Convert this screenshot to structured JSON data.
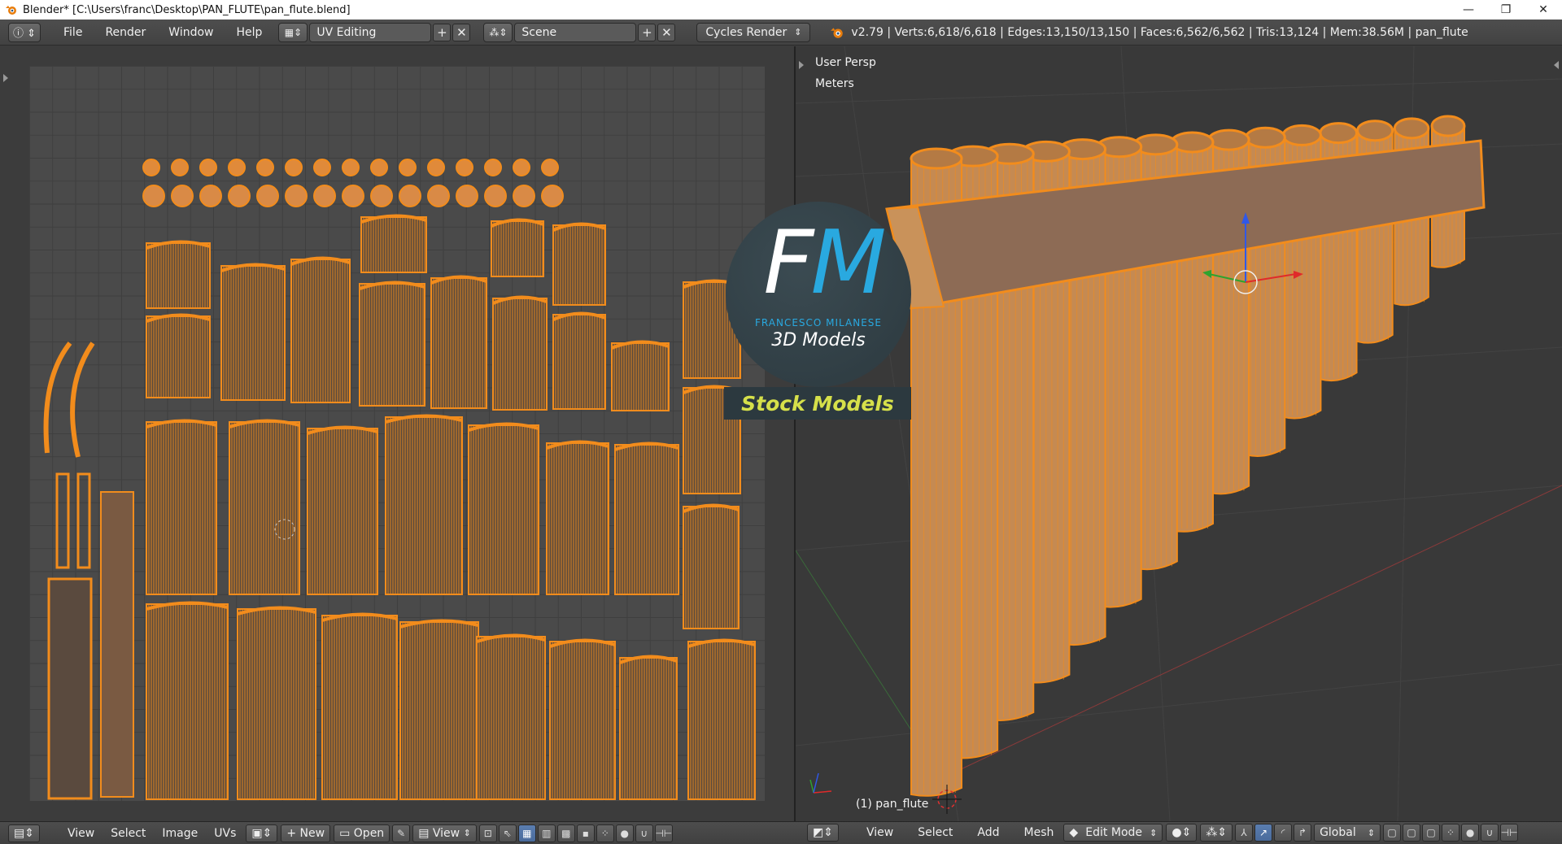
{
  "window": {
    "title": "Blender* [C:\\Users\\franc\\Desktop\\PAN_FLUTE\\pan_flute.blend]",
    "minimize": "—",
    "restore": "❐",
    "close": "✕"
  },
  "header": {
    "menus": [
      "File",
      "Render",
      "Window",
      "Help"
    ],
    "screen_layout": "UV Editing",
    "scene": "Scene",
    "render_engine": "Cycles Render",
    "stats": "v2.79 | Verts:6,618/6,618 | Edges:13,150/13,150 | Faces:6,562/6,562 | Tris:13,124 | Mem:38.56M | pan_flute"
  },
  "viewport": {
    "view_name": "User Persp",
    "units": "Meters",
    "object_label": "(1) pan_flute"
  },
  "watermark": {
    "letter_f": "F",
    "letter_m": "M",
    "name": "FRANCESCO MILANESE",
    "subtitle": "3D Models",
    "banner": "Stock Models"
  },
  "uv_footer": {
    "menus": [
      "View",
      "Select",
      "Image",
      "UVs"
    ],
    "new_label": "New",
    "open_label": "Open",
    "view_label": "View"
  },
  "view3d_footer": {
    "menus": [
      "View",
      "Select",
      "Add",
      "Mesh"
    ],
    "mode": "Edit Mode",
    "orientation": "Global"
  },
  "colors": {
    "mesh_orange": "#f28c1c",
    "mesh_fill": "#c58a52",
    "accent_blue": "#29a9e0",
    "stock_yellow": "#d6e04a"
  }
}
